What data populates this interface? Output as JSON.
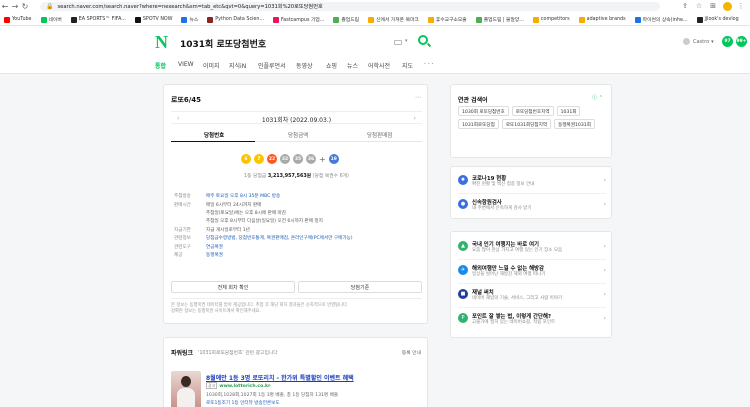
{
  "browser": {
    "url": "search.naver.com/search.naver?where=nexearch&sm=tab_etc&qvt=0&query=1031%EB%A1%9C%EB%98%90%EB%8B%B9%EC%B2%A8%EB%B2%88%ED%98%B8",
    "url_display": "search.naver.com/search.naver?where=nexearch&sm=tab_etc&qvt=0&query=1031회%20로또당첨번호",
    "bookmarks": [
      {
        "label": "YouTube",
        "color": "#ff0000"
      },
      {
        "label": "네이버",
        "color": "#03c75a"
      },
      {
        "label": "EA SPORTS™ FIFA...",
        "color": "#222222"
      },
      {
        "label": "SPOTV NOW",
        "color": "#111111"
      },
      {
        "label": "뉴스",
        "color": "#1a73e8"
      },
      {
        "label": "Python Data Scien...",
        "color": "#8e2424"
      },
      {
        "label": "Fastcampus 기업...",
        "color": "#e8175d"
      },
      {
        "label": "졸업드림",
        "color": "#4caf50"
      },
      {
        "label": "신에서 가져온 북마크",
        "color": "#f9ab00"
      },
      {
        "label": "휴수교구소모줄",
        "color": "#f9ab00"
      },
      {
        "label": "졸업드림 | 불알양...",
        "color": "#4caf50"
      },
      {
        "label": "competitors",
        "color": "#f9ab00"
      },
      {
        "label": "adaptive brands",
        "color": "#f9ab00"
      },
      {
        "label": "파이썬의 상속(inhe...",
        "color": "#1a73e8"
      },
      {
        "label": "jjlook's devlog",
        "color": "#222222"
      }
    ]
  },
  "header": {
    "logo": "N",
    "query": "1031회 로또당첨번호",
    "account": "Castro",
    "badge1": "97",
    "badge2": "99+"
  },
  "tabs": [
    "통합",
    "VIEW",
    "이미지",
    "지식iN",
    "인플루언서",
    "동영상",
    "쇼핑",
    "뉴스",
    "어학사전",
    "지도",
    "· · ·"
  ],
  "lotto": {
    "title": "로또6/45",
    "round": "1031회차 (2022.09.03.)",
    "subtabs": [
      "당첨번호",
      "당첨금액",
      "당첨판매점"
    ],
    "balls": [
      {
        "n": "6",
        "color": "#fbc400"
      },
      {
        "n": "7",
        "color": "#fbc400"
      },
      {
        "n": "22",
        "color": "#ff5722"
      },
      {
        "n": "32",
        "color": "#aaaaaa"
      },
      {
        "n": "35",
        "color": "#aaaaaa"
      },
      {
        "n": "36",
        "color": "#aaaaaa"
      }
    ],
    "bonus": {
      "n": "19",
      "color": "#4a78d6"
    },
    "prize_prefix": "1등 당첨금",
    "prize_amount": "3,213,957,563원",
    "prize_suffix": "(당첨 복권수 6개)",
    "info": [
      {
        "key": "추첨방송",
        "val": "매주 토요일 오후 8시 35분 MBC 방송",
        "type": "link"
      },
      {
        "key": "판매시간",
        "val": "매일 6시부터 24시까지 판매",
        "type": "plain"
      },
      {
        "key": "",
        "val": "추첨일(토요일)에는 오후 8시에 판매 마감",
        "type": "plain"
      },
      {
        "key": "",
        "val": "추첨일 오후 8시부터 다음날(일요일) 오전 6시까지 판매 정지",
        "type": "plain"
      },
      {
        "key": "지급기한",
        "val": "지급 개시일로부터 1년",
        "type": "plain"
      },
      {
        "key": "관련정보",
        "val": "당첨금수령방법, 당첨번호통계, 복권판매점, 온라인구매(PC에서만 구매가능)",
        "type": "link"
      },
      {
        "key": "관련도구",
        "val": "연금복권",
        "type": "link"
      },
      {
        "key": "제공",
        "val": "동행복권",
        "type": "link"
      }
    ],
    "btn_all": "전체 회차 확인",
    "btn_check": "당첨기준",
    "disclaimer_1": "본 정보는 동행복권 데이터를 받아 제공합니다. 추첨 후 해당 회차 결과들은 순차적으로 반영됩니다.",
    "disclaimer_2": "정확한 정보는 동행복권 사이트에서 확인해주세요."
  },
  "ad": {
    "title": "파워링크",
    "subtitle": "'1031회로또당첨번호' 관련 광고입니다",
    "register": "등록 안내",
    "headline": "8월에만 1등 3명 로또리치 - 한가위 특별할인 이벤트 혜택",
    "url_tag": "광고",
    "url": "www.lottorich.co.kr",
    "desc": "1030회,1028회,1027회 1등 3명 배출, 총 1등 당첨자 131명 배출",
    "links": "로또1등조기  1등 인터뷰  방송언론보도"
  },
  "related": {
    "title": "연관 검색어",
    "chips": [
      "1030회 로또당첨번호",
      "로또당첨번호지역",
      "1031회",
      "1031회로또당첨",
      "로또1031회당첨지역",
      "동행복권1031회"
    ]
  },
  "right_items": [
    {
      "title": "코로나19 현황",
      "desc": "확진 현황 및 백신 접종 정보 안내",
      "icon": "virus-icon",
      "color": "#3a6fe0",
      "glyph": "✹"
    },
    {
      "title": "신속항원검사",
      "desc": "내 주변에서 신속하게 검사 받기",
      "icon": "location-icon",
      "color": "#3a6fe0",
      "glyph": "●"
    },
    {
      "title": "국내 인기 여행지는 바로 여기",
      "desc": "요즘 많이 관심 가지고 여행 있는 인기 장소 모음",
      "icon": "travel-icon",
      "color": "#2fb36e",
      "glyph": "▲"
    },
    {
      "title": "해외여행만 느낄 수 없는 해방감",
      "desc": "일상을 벗어난 해방감 해외 여행 떠나기",
      "icon": "plane-icon",
      "color": "#1a8be8",
      "glyph": "✈"
    },
    {
      "title": "재널 써치",
      "desc": "네이버 재널의 기술, 서비스, 그리고 사람 이야기",
      "icon": "channel-icon",
      "color": "#1f3f9e",
      "glyph": "■"
    },
    {
      "title": "포인트 잘 쌓는 법, 이렇게 간단해?",
      "desc": "고물가에 필히 있는 네이버쇼핑, 적립 포인트",
      "icon": "point-icon",
      "color": "#2fb36e",
      "glyph": "P"
    }
  ]
}
